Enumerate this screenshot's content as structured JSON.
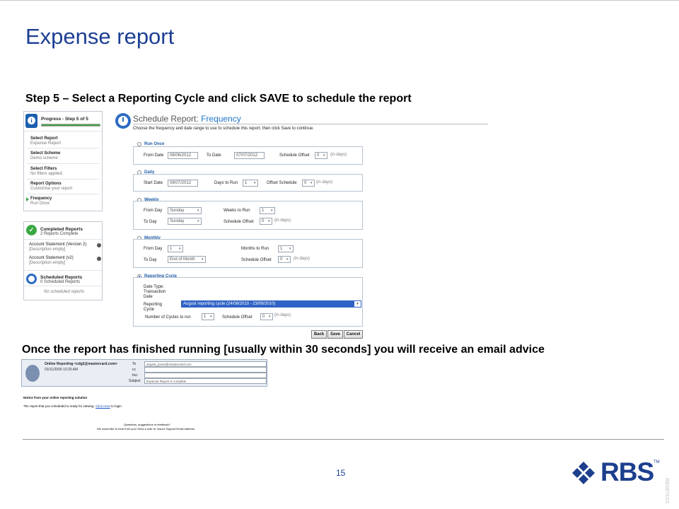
{
  "slide": {
    "title": "Expense report",
    "step_heading": "Step 5 – Select a Reporting Cycle and  click SAVE to schedule the report",
    "email_heading": "Once the report has finished running [usually within 30 seconds] you will receive an email advice",
    "page_number": "15",
    "logo_text": "RBS",
    "trademark": "TM",
    "side_code": "RBS87XXX"
  },
  "progress": {
    "title": "Progress - Step 5 of 5",
    "percent": 100,
    "steps": [
      {
        "label": "Select Report",
        "sub": "Expense Report"
      },
      {
        "label": "Select Scheme",
        "sub": "Demo scheme"
      },
      {
        "label": "Select Filters",
        "sub": "No filters applied."
      },
      {
        "label": "Report Options",
        "sub": "Customise your report"
      },
      {
        "label": "Frequency",
        "sub": "Run Once"
      }
    ]
  },
  "completed": {
    "title": "Completed Reports",
    "sub": "2 Reports Complete",
    "items": [
      {
        "label": "Account Statement (Version 2)",
        "sub": "[Description empty]"
      },
      {
        "label": "Account Statement (v2)",
        "sub": "[Description empty]"
      }
    ]
  },
  "scheduled": {
    "title": "Scheduled Reports",
    "sub": "0 Scheduled Reports",
    "empty": "No scheduled reports"
  },
  "schedule": {
    "title_prefix": "Schedule Report:",
    "title_highlight": "Frequency",
    "instruction": "Choose the frequency and date range to use to schedule this report, then click Save to continue.",
    "in_days": "(in days)",
    "run_once": {
      "label": "Run Once",
      "from_label": "From Date",
      "from": "08/06/2012",
      "to_label": "To Date",
      "to": "07/07/2012",
      "offset_label": "Schedule Offset",
      "offset": "0"
    },
    "daily": {
      "label": "Daily",
      "start_label": "Start Date",
      "start": "08/07/2012",
      "days_label": "Days to Run",
      "days": "1",
      "offset_label": "Offset Schedule",
      "offset": "0"
    },
    "weekly": {
      "label": "Weekly",
      "from_label": "From Day",
      "from": "Sunday",
      "to_label": "To Day",
      "to": "Sunday",
      "weeks_label": "Weeks to Run",
      "weeks": "1",
      "offset_label": "Schedule Offset",
      "offset": "0"
    },
    "monthly": {
      "label": "Monthly",
      "from_label": "From Day",
      "from": "1",
      "to_label": "To Day",
      "to": "End of Month",
      "months_label": "Months to Run",
      "months": "1",
      "offset_label": "Schedule Offset",
      "offset": "0"
    },
    "cycle": {
      "label": "Reporting Cycle",
      "date_type_label": "Date Type:",
      "date_type": "Transaction Date",
      "rc_label": "Reporting Cycle",
      "rc_value": "August reporting cycle (24/08/2010 - 23/09/2010)",
      "num_label": "Number of Cycles to run",
      "num": "1",
      "offset_label": "Schedule Offset",
      "offset": "0"
    },
    "buttons": {
      "back": "Back",
      "save": "Save",
      "cancel": "Cancel"
    }
  },
  "email": {
    "from_name": "Online Reporting <cdg2@mastercard.com>",
    "date": "03/11/2009 10:29 AM",
    "to_label": "To",
    "to": "angela_jones@mastercard.com",
    "cc_label": "cc",
    "bcc_label": "bcc",
    "subject_label": "Subject",
    "subject": "Expense Report is complete",
    "notice": "Notice from your online reporting solution",
    "body_pre": "The report that you scheduled is ready for viewing.",
    "link": "Click Here",
    "body_post": "to login.",
    "footer1": "Questions, suggestions or feedback?",
    "footer2": "We would like to hear from you! Send a note to: Issuer Support Email address."
  },
  "colors": {
    "title": "#1c3f94",
    "logo": "#1d3f8e",
    "link": "#1a52c8",
    "progress": "#43a047"
  }
}
